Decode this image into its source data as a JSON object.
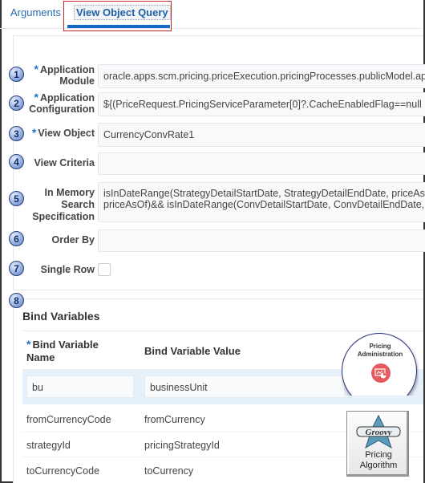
{
  "tabs": {
    "items": [
      {
        "label": "Arguments",
        "active": false
      },
      {
        "label": "View Object Query",
        "active": true
      }
    ]
  },
  "form": {
    "fields": [
      {
        "step": "1",
        "label_line1": "Application",
        "label_line2": "Module",
        "required": true,
        "value": "oracle.apps.scm.pricing.priceExecution.pricingProcesses.publicModel.ap"
      },
      {
        "step": "2",
        "label_line1": "Application",
        "label_line2": "Configuration",
        "required": true,
        "value": "${(PriceRequest.PricingServiceParameter[0]?.CacheEnabledFlag==null"
      },
      {
        "step": "3",
        "label_line1": "View Object",
        "required": true,
        "value": "CurrencyConvRate1"
      },
      {
        "step": "4",
        "label_line1": "View Criteria",
        "required": false,
        "value": ""
      },
      {
        "step": "5",
        "label_line1": "In Memory",
        "label_line2": "Search",
        "label_line3": "Specification",
        "required": false,
        "value_line1": "isInDateRange(StrategyDetailStartDate, StrategyDetailEndDate, priceAs",
        "value_line2": "priceAsOf)&& isInDateRange(ConvDetailStartDate, ConvDetailEndDate,"
      },
      {
        "step": "6",
        "label_line1": "Order By",
        "required": false,
        "value": ""
      },
      {
        "step": "7",
        "label_line1": "Single Row",
        "required": false,
        "checked": false
      }
    ],
    "required_marker": "*"
  },
  "bind_variables": {
    "step": "8",
    "title": "Bind Variables",
    "columns": {
      "name_line1": "Bind Variable",
      "name_line2": "Name",
      "value": "Bind Variable Value"
    },
    "rows": [
      {
        "name": "bu",
        "value": "businessUnit"
      },
      {
        "name": "fromCurrencyCode",
        "value": "fromCurrency"
      },
      {
        "name": "strategyId",
        "value": "pricingStrategyId"
      },
      {
        "name": "toCurrencyCode",
        "value": "toCurrency"
      }
    ]
  },
  "badges": {
    "admin": {
      "line1": "Pricing",
      "line2": "Administration"
    },
    "groovy": {
      "logo": "Groovy",
      "line1": "Pricing",
      "line2": "Algorithm"
    }
  },
  "colors": {
    "accent": "#1469c8",
    "highlight_box": "#c8262f",
    "required": "#1f73c9",
    "selected_row": "#e6f0fb",
    "admin_icon": "#e45a5f"
  }
}
